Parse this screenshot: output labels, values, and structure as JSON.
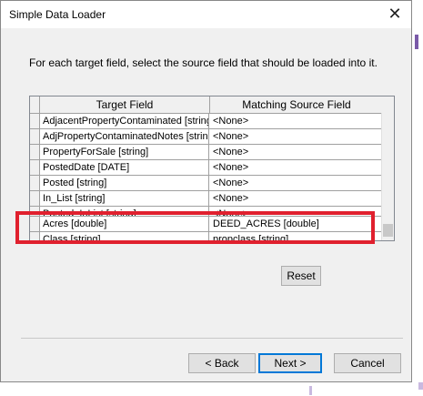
{
  "window": {
    "title": "Simple Data Loader"
  },
  "instructions": "For each target field, select the source field that should be loaded into it.",
  "grid": {
    "headers": {
      "target": "Target Field",
      "source": "Matching Source Field"
    },
    "rows": [
      {
        "target": "AdjacentPropertyContaminated [string",
        "source": "<None>"
      },
      {
        "target": "AdjPropertyContaminatedNotes [string",
        "source": "<None>"
      },
      {
        "target": "PropertyForSale [string]",
        "source": "<None>"
      },
      {
        "target": "PostedDate [DATE]",
        "source": "<None>"
      },
      {
        "target": "Posted [string]",
        "source": "<None>"
      },
      {
        "target": "In_List [string]",
        "source": "<None>"
      },
      {
        "target": "Posted_InList [string]",
        "source": "<None>"
      },
      {
        "target": "Acres [double]",
        "source": "DEED_ACRES [double]"
      },
      {
        "target": "Class [string]",
        "source": "propclass [string]"
      }
    ]
  },
  "buttons": {
    "reset": "Reset",
    "back": "< Back",
    "next": "Next >",
    "cancel": "Cancel"
  },
  "colors": {
    "highlight": "#e0202e",
    "default_button_border": "#0078d7"
  }
}
